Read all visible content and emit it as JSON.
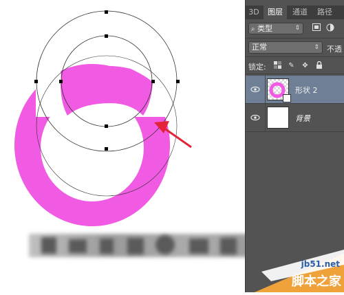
{
  "layers_panel": {
    "tabs": [
      {
        "label": "3D",
        "active": false
      },
      {
        "label": "图层",
        "active": true
      },
      {
        "label": "通道",
        "active": false
      },
      {
        "label": "路径",
        "active": false
      }
    ],
    "filter_type": "类型",
    "filter_icons": [
      "filter-search-icon",
      "image-filter-icon",
      "adjustment-filter-icon"
    ],
    "blend_mode": "正常",
    "opacity_label": "不透",
    "lock_label": "锁定:",
    "lock_icons": [
      "lock-transparent-icon",
      "lock-pixels-icon",
      "lock-position-icon",
      "lock-all-icon"
    ],
    "layers": [
      {
        "name": "形状 2",
        "selected": true,
        "visible": true
      },
      {
        "name": "背景",
        "selected": false,
        "visible": true
      }
    ]
  },
  "canvas": {
    "ring_color": "#f15ae3",
    "arrow_color": "#e32338",
    "selection_color": "#1f5fbf"
  },
  "watermark": {
    "url": "jb51.net",
    "site_name": "脚本之家"
  },
  "colors": {
    "panel_bg": "#535353",
    "selected_layer": "#6f7f95"
  }
}
